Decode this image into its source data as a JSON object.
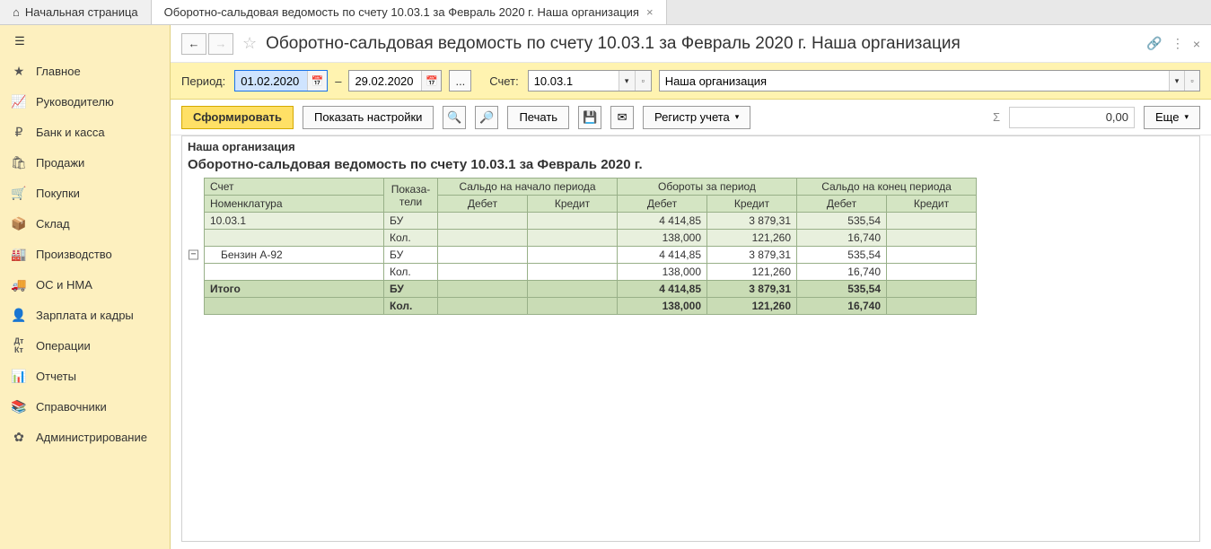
{
  "tabs": {
    "home": "Начальная страница",
    "report": "Оборотно-сальдовая ведомость по счету 10.03.1 за Февраль 2020 г. Наша организация"
  },
  "sidebar": {
    "items": [
      {
        "icon": "star",
        "label": "Главное"
      },
      {
        "icon": "chart",
        "label": "Руководителю"
      },
      {
        "icon": "ruble",
        "label": "Банк и касса"
      },
      {
        "icon": "bag",
        "label": "Продажи"
      },
      {
        "icon": "cart",
        "label": "Покупки"
      },
      {
        "icon": "box",
        "label": "Склад"
      },
      {
        "icon": "factory",
        "label": "Производство"
      },
      {
        "icon": "truck",
        "label": "ОС и НМА"
      },
      {
        "icon": "person",
        "label": "Зарплата и кадры"
      },
      {
        "icon": "dtkt",
        "label": "Операции"
      },
      {
        "icon": "bars",
        "label": "Отчеты"
      },
      {
        "icon": "books",
        "label": "Справочники"
      },
      {
        "icon": "gear",
        "label": "Администрирование"
      }
    ]
  },
  "header": {
    "title": "Оборотно-сальдовая ведомость по счету 10.03.1 за Февраль 2020 г. Наша организация"
  },
  "filter": {
    "period_label": "Период:",
    "date_from": "01.02.2020",
    "date_to": "29.02.2020",
    "dash": "–",
    "ellipsis": "...",
    "account_label": "Счет:",
    "account": "10.03.1",
    "org": "Наша организация"
  },
  "toolbar": {
    "form": "Сформировать",
    "settings": "Показать настройки",
    "print": "Печать",
    "register": "Регистр учета",
    "more": "Еще",
    "sum_placeholder": "0,00",
    "sigma": "Σ"
  },
  "report": {
    "org_name": "Наша организация",
    "title": "Оборотно-сальдовая ведомость по счету 10.03.1 за Февраль 2020 г.",
    "headers": {
      "account": "Счет",
      "indicators": "Показа-\nтели",
      "open_balance": "Сальдо на начало периода",
      "turnover": "Обороты за период",
      "close_balance": "Сальдо на конец периода",
      "nomenclature": "Номенклатура",
      "debit": "Дебет",
      "credit": "Кредит"
    },
    "rows": [
      {
        "type": "acc",
        "name": "10.03.1",
        "ind": "БУ",
        "ob_d": "",
        "ob_c": "",
        "t_d": "4 414,85",
        "t_c": "3 879,31",
        "cb_d": "535,54",
        "cb_c": ""
      },
      {
        "type": "acc",
        "name": "",
        "ind": "Кол.",
        "ob_d": "",
        "ob_c": "",
        "t_d": "138,000",
        "t_c": "121,260",
        "cb_d": "16,740",
        "cb_c": ""
      },
      {
        "type": "item",
        "name": "Бензин А-92",
        "ind": "БУ",
        "ob_d": "",
        "ob_c": "",
        "t_d": "4 414,85",
        "t_c": "3 879,31",
        "cb_d": "535,54",
        "cb_c": ""
      },
      {
        "type": "item",
        "name": "",
        "ind": "Кол.",
        "ob_d": "",
        "ob_c": "",
        "t_d": "138,000",
        "t_c": "121,260",
        "cb_d": "16,740",
        "cb_c": ""
      }
    ],
    "totals": [
      {
        "name": "Итого",
        "ind": "БУ",
        "ob_d": "",
        "ob_c": "",
        "t_d": "4 414,85",
        "t_c": "3 879,31",
        "cb_d": "535,54",
        "cb_c": ""
      },
      {
        "name": "",
        "ind": "Кол.",
        "ob_d": "",
        "ob_c": "",
        "t_d": "138,000",
        "t_c": "121,260",
        "cb_d": "16,740",
        "cb_c": ""
      }
    ]
  }
}
